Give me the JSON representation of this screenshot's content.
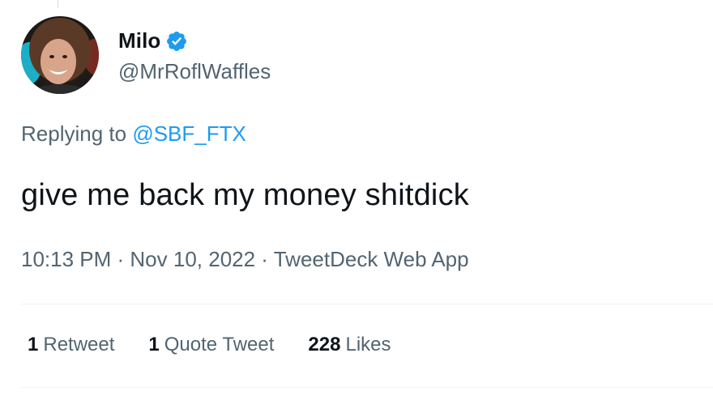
{
  "user": {
    "display_name": "Milo",
    "handle": "@MrRoflWaffles",
    "verified": true,
    "verified_color": "#1d9bf0"
  },
  "reply": {
    "prefix": "Replying to ",
    "mention": "@SBF_FTX"
  },
  "tweet": {
    "text": "give me back my money shitdick"
  },
  "meta": {
    "time": "10:13 PM",
    "separator1": " · ",
    "date": "Nov 10, 2022",
    "separator2": " · ",
    "source": "TweetDeck Web App"
  },
  "stats": {
    "retweets_count": "1",
    "retweets_label": "Retweet",
    "quotes_count": "1",
    "quotes_label": "Quote Tweet",
    "likes_count": "228",
    "likes_label": "Likes"
  },
  "colors": {
    "link": "#1d9bf0",
    "secondary_text": "#536471",
    "primary_text": "#0f1419"
  }
}
